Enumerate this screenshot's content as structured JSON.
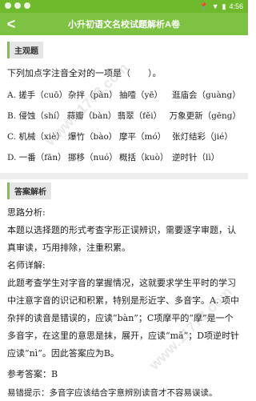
{
  "status_bar": {
    "time": "4:56"
  },
  "app_bar": {
    "title": "小升初语文名校试题解析A卷"
  },
  "question_section": {
    "tag": "主观题",
    "stem": "下列加点字注音全对的一项是（　　）。",
    "options": [
      [
        "A. 搓手（cuō）",
        "杂拌（pàn）",
        "抽噎（yē）",
        "逛庙会（guàng）"
      ],
      [
        "B. 侵蚀（shí）",
        "蒜瓣（bàn）",
        "翡翠（fěi）",
        "万象更新（gēng）"
      ],
      [
        "C. 机械（xiè）",
        "爆竹（bào）",
        "摩平（mó）",
        "张灯结彩（jié）"
      ],
      [
        "D. 一番（fān）",
        "挪移（nuó）",
        "概括（kuò）",
        "逆时针（lì）"
      ]
    ]
  },
  "answer_section": {
    "tag": "答案解析",
    "analysis_label": "思路分析:",
    "analysis_text": "本题以选择题的形式考查字形正误辨识，需要逐字审题，认真审读，巧用排除，注重积累。",
    "teacher_label": "名师详解:",
    "teacher_text": "此题考查学生对字音的掌握情况，这就要求学生平时的学习中注意字音的识记和积累，特别是形近字、多音字。A. 项中杂拌的读音是错误的，应读“bàn”；C项摩平的“摩”是一个多音字，在这里的意思是抹，展开，应读“mā”；D项逆时针应读“nì”。因此答案应为B。",
    "answer_label": "参考答案：",
    "answer_value": "B",
    "tip_label": "易错提示：",
    "tip_text": "多音字应该结合字意辨别读音才不容易误读。"
  },
  "watermark": "www.11773.com"
}
